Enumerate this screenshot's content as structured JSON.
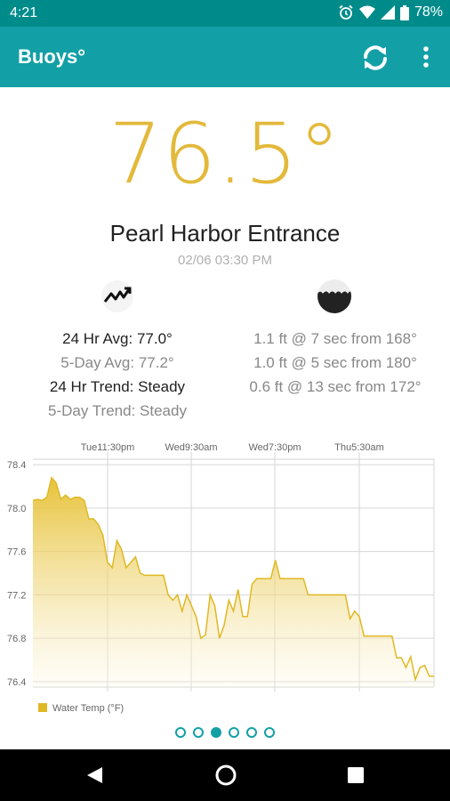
{
  "status": {
    "time": "4:21",
    "battery": "78%"
  },
  "app": {
    "title": "Buoys°"
  },
  "current": {
    "temperature": "76.5°",
    "station": "Pearl Harbor Entrance",
    "timestamp": "02/06 03:30 PM"
  },
  "stats": {
    "avg_24": "24 Hr Avg: 77.0°",
    "avg_5day": "5-Day Avg: 77.2°",
    "trend_24": "24 Hr Trend: Steady",
    "trend_5day": "5-Day Trend: Steady"
  },
  "waves": [
    "1.1 ft @ 7 sec from 168°",
    "1.0 ft @ 5 sec from 180°",
    "0.6 ft @ 13 sec from 172°"
  ],
  "icons": {
    "trend": "trend-up-icon",
    "waves": "wave-icon",
    "refresh": "refresh-icon",
    "menu": "more-vert-icon"
  },
  "colors": {
    "accent": "#12a0a6",
    "status": "#008b8b",
    "temp": "#e3b93a",
    "series": "#e6bf2e"
  },
  "pager": {
    "count": 6,
    "active": 2
  },
  "chart_data": {
    "type": "area",
    "x_ticks": [
      "Tue11:30pm",
      "Wed9:30am",
      "Wed7:30pm",
      "Thu5:30am"
    ],
    "y_ticks": [
      "78.4",
      "78.0",
      "77.6",
      "77.2",
      "76.8",
      "76.4"
    ],
    "ylim": [
      76.35,
      78.45
    ],
    "legend": "Water Temp (°F)",
    "legend_position": "bottom-left",
    "grid": true,
    "series": [
      {
        "name": "Water Temp (°F)",
        "values": [
          78.07,
          78.08,
          78.07,
          78.1,
          78.28,
          78.23,
          78.08,
          78.12,
          78.08,
          78.1,
          78.1,
          78.07,
          77.9,
          77.9,
          77.85,
          77.75,
          77.5,
          77.45,
          77.7,
          77.62,
          77.45,
          77.5,
          77.55,
          77.4,
          77.38,
          77.38,
          77.38,
          77.38,
          77.38,
          77.2,
          77.15,
          77.2,
          77.05,
          77.2,
          77.1,
          77.0,
          76.8,
          76.83,
          77.2,
          77.1,
          76.8,
          76.92,
          77.15,
          77.05,
          77.25,
          77.0,
          77.0,
          77.3,
          77.35,
          77.35,
          77.35,
          77.35,
          77.52,
          77.35,
          77.35,
          77.35,
          77.35,
          77.35,
          77.35,
          77.2,
          77.2,
          77.2,
          77.2,
          77.2,
          77.2,
          77.2,
          77.2,
          77.2,
          76.98,
          77.05,
          77.0,
          76.82,
          76.82,
          76.82,
          76.82,
          76.82,
          76.82,
          76.82,
          76.62,
          76.62,
          76.53,
          76.63,
          76.42,
          76.53,
          76.55,
          76.45,
          76.45
        ]
      }
    ]
  }
}
